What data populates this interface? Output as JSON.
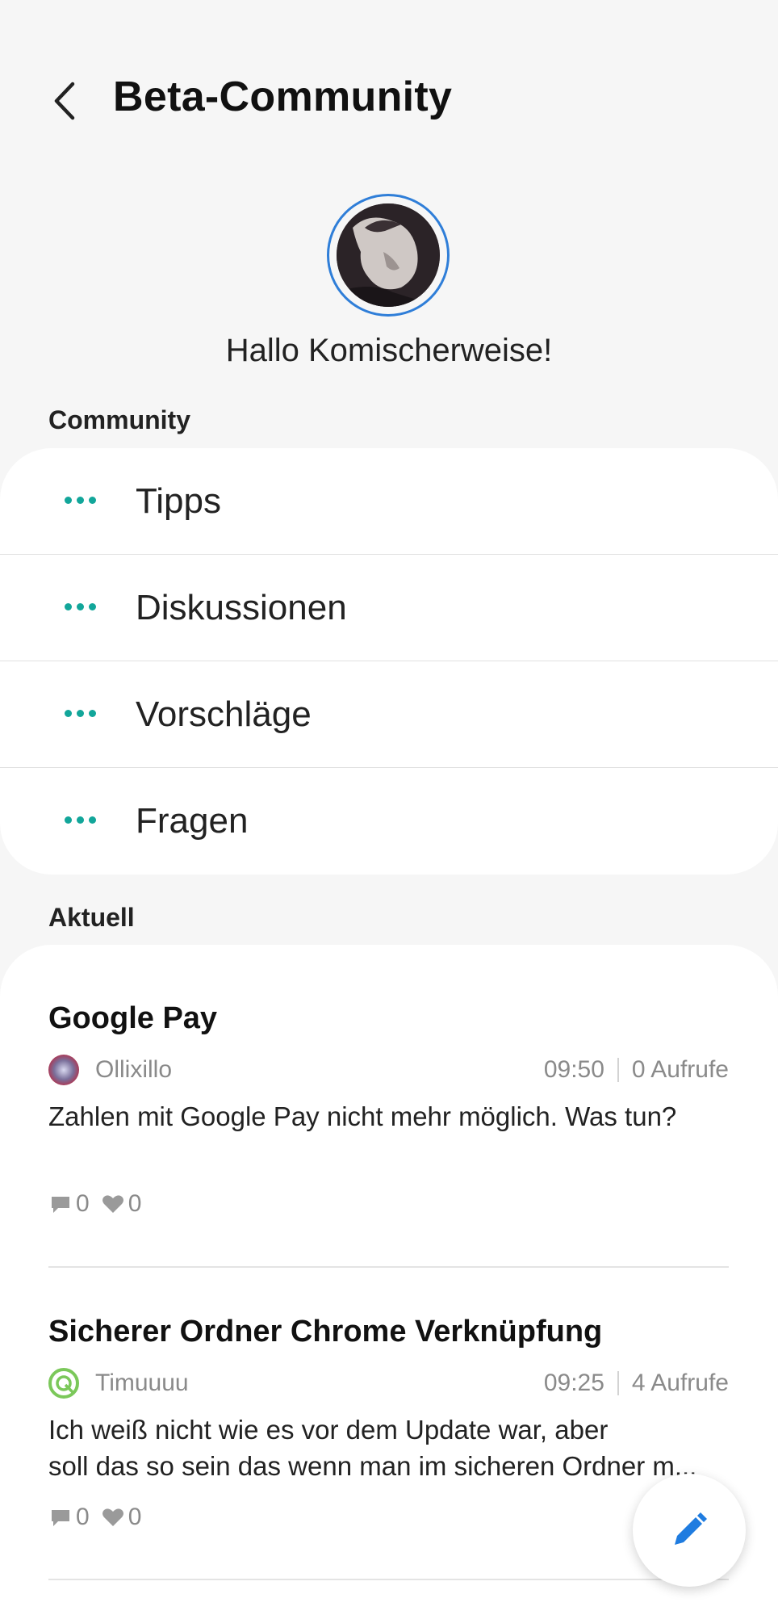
{
  "header": {
    "title": "Beta-Community"
  },
  "profile": {
    "greeting": "Hallo Komischerweise!"
  },
  "community": {
    "label": "Community",
    "items": [
      {
        "label": "Tipps"
      },
      {
        "label": "Diskussionen"
      },
      {
        "label": "Vorschläge"
      },
      {
        "label": "Fragen"
      }
    ]
  },
  "recent": {
    "label": "Aktuell",
    "posts": [
      {
        "title": "Google Pay",
        "author": "Ollixillo",
        "time": "09:50",
        "views": "0 Aufrufe",
        "body_line1": "Zahlen mit Google Pay nicht mehr möglich. Was tun?",
        "body_line2": "",
        "comments": "0",
        "likes": "0"
      },
      {
        "title": "Sicherer Ordner Chrome Verknüpfung",
        "author": "Timuuuu",
        "time": "09:25",
        "views": "4 Aufrufe",
        "body_line1": "Ich weiß nicht wie es vor dem Update war, aber",
        "body_line2": "soll das so sein das wenn man im sicheren Ordner m...",
        "comments": "0",
        "likes": "0"
      }
    ]
  },
  "colors": {
    "accent_teal": "#12a69a",
    "fab_blue": "#1f7ce0",
    "avatar_ring": "#2f7ed8"
  },
  "icons": {
    "back": "chevron-left-icon",
    "menu": "more-dots-icon",
    "comment": "comment-icon",
    "like": "heart-icon",
    "compose": "pencil-icon"
  }
}
